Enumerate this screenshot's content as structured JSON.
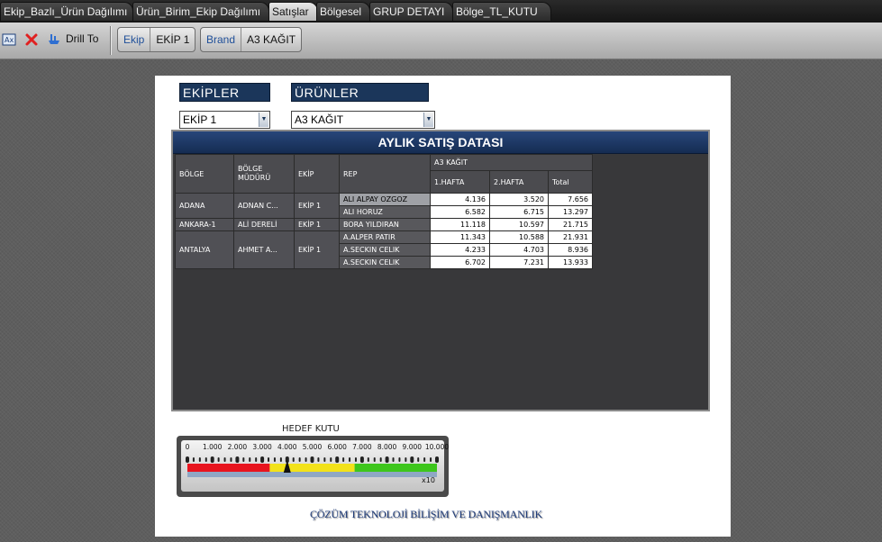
{
  "tabs": [
    {
      "label": "Ekip_Bazlı_Ürün Dağılımı",
      "active": false
    },
    {
      "label": "Ürün_Birim_Ekip Dağılımı",
      "active": false
    },
    {
      "label": "Satışlar",
      "active": true
    },
    {
      "label": "Bölgesel",
      "active": false
    },
    {
      "label": "GRUP DETAYI",
      "active": false
    },
    {
      "label": "Bölge_TL_KUTU",
      "active": false
    }
  ],
  "toolbar": {
    "drill_label": "Drill To",
    "chips": [
      {
        "key": "Ekip",
        "value": "EKİP 1"
      },
      {
        "key": "Brand",
        "value": "A3 KAĞIT"
      }
    ]
  },
  "filters": {
    "ekipler": {
      "header": "EKİPLER",
      "value": "EKİP 1"
    },
    "urunler": {
      "header": "ÜRÜNLER",
      "value": "A3 KAĞIT"
    }
  },
  "table": {
    "title": "AYLIK SATIŞ DATASI",
    "headers": {
      "bolge": "BÖLGE",
      "mudur": "BÖLGE\nMÜDÜRÜ",
      "ekip": "EKİP",
      "rep": "REP",
      "product": "A3 KAĞIT",
      "w1": "1.HAFTA",
      "w2": "2.HAFTA",
      "total": "Total"
    },
    "groups": [
      {
        "bolge": "ADANA",
        "mudur": "ADNAN  C...",
        "ekip": "EKİP 1",
        "rows": [
          {
            "rep": "ALI ALPAY OZGOZ",
            "w1": "4.136",
            "w2": "3.520",
            "total": "7.656",
            "selected": true
          },
          {
            "rep": "ALI HORUZ",
            "w1": "6.582",
            "w2": "6.715",
            "total": "13.297",
            "selected": false
          }
        ]
      },
      {
        "bolge": "ANKARA-1",
        "mudur": "ALİ DERELİ",
        "ekip": "EKİP 1",
        "rows": [
          {
            "rep": "BORA YILDIRAN",
            "w1": "11.118",
            "w2": "10.597",
            "total": "21.715",
            "selected": false
          }
        ]
      },
      {
        "bolge": "ANTALYA",
        "mudur": "AHMET  A...",
        "ekip": "EKİP 1",
        "rows": [
          {
            "rep": "A.ALPER PATIR",
            "w1": "11.343",
            "w2": "10.588",
            "total": "21.931",
            "selected": false
          },
          {
            "rep": "A.SECKIN CELIK",
            "w1": "4.233",
            "w2": "4.703",
            "total": "8.936",
            "selected": false
          },
          {
            "rep": "A.SECKIN CELIK",
            "w1": "6.702",
            "w2": "7.231",
            "total": "13.933",
            "selected": false
          }
        ]
      }
    ]
  },
  "gauge": {
    "title": "HEDEF KUTU",
    "ticks": [
      "0",
      "1.000",
      "2.000",
      "3.000",
      "4.000",
      "5.000",
      "6.000",
      "7.000",
      "8.000",
      "9.000",
      "10.000"
    ],
    "multiplier": "x10",
    "min": 0,
    "max": 10000,
    "value": 4000,
    "bands": [
      {
        "from": 0,
        "to": 3300,
        "color": "#e8141e"
      },
      {
        "from": 3300,
        "to": 6700,
        "color": "#f2e21a"
      },
      {
        "from": 6700,
        "to": 10000,
        "color": "#3dc61c"
      }
    ]
  },
  "footer": "ÇÖZÜM TEKNOLOJİ BİLİŞİM VE DANIŞMANLIK"
}
